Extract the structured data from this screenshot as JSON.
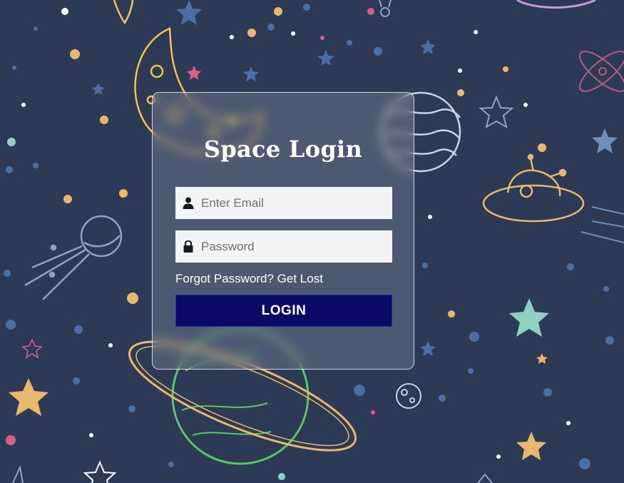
{
  "page": {
    "title": "Space Login"
  },
  "form": {
    "email": {
      "placeholder": "Enter Email",
      "value": "",
      "icon": "user-icon"
    },
    "password": {
      "placeholder": "Password",
      "value": "",
      "icon": "lock-icon"
    },
    "forgot_text": "Forgot Password? Get Lost",
    "login_label": "LOGIN"
  },
  "colors": {
    "background": "#2c3a56",
    "button": "#0a0966",
    "planet_ring": "#e9b86f",
    "planet_green": "#5cc46b",
    "moon": "#f2c453"
  }
}
